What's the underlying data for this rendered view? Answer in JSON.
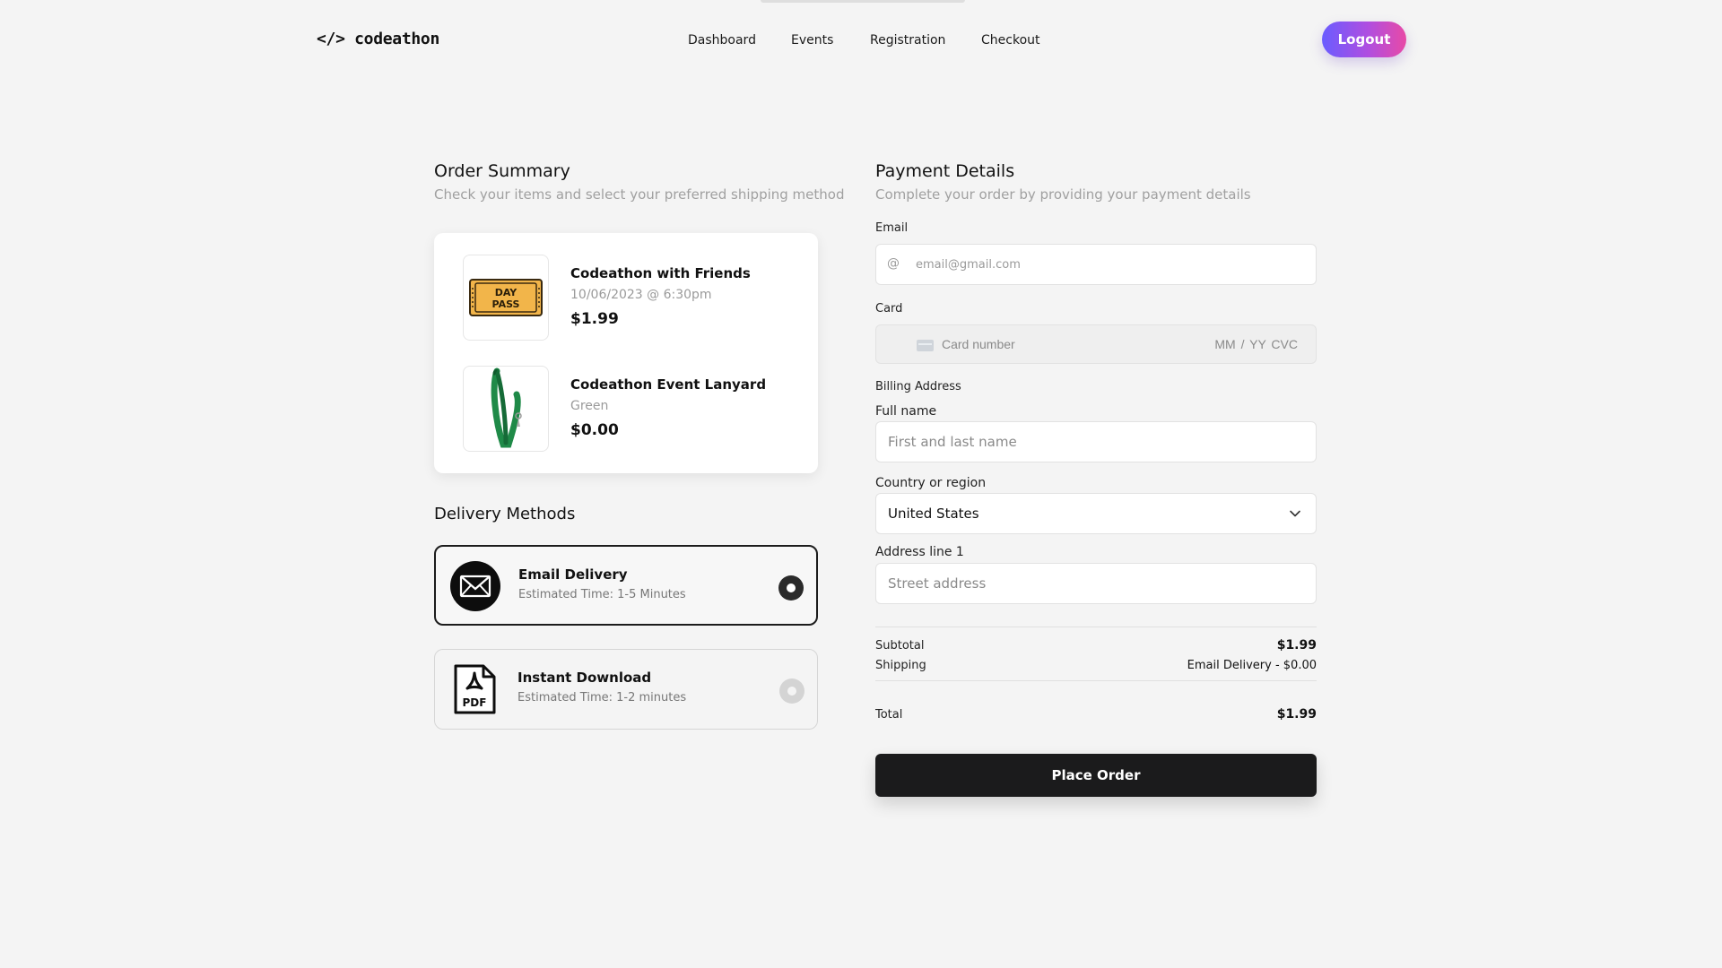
{
  "header": {
    "logo": "</> codeathon",
    "nav": [
      "Dashboard",
      "Events",
      "Registration",
      "Checkout"
    ],
    "logout_label": "Logout"
  },
  "order_summary": {
    "title": "Order Summary",
    "subtitle": "Check your items and select your preferred shipping method",
    "items": [
      {
        "name": "Codeathon with Friends",
        "meta": "10/06/2023 @ 6:30pm",
        "price": "$1.99",
        "image": "day-pass-ticket-icon",
        "image_text": "DAY PASS"
      },
      {
        "name": "Codeathon Event Lanyard",
        "meta": "Green",
        "price": "$0.00",
        "image": "green-lanyard-icon"
      }
    ]
  },
  "delivery": {
    "title": "Delivery Methods",
    "methods": [
      {
        "title": "Email Delivery",
        "subtitle": "Estimated Time: 1-5 Minutes",
        "icon": "envelope-icon",
        "selected": true
      },
      {
        "title": "Instant Download",
        "subtitle": "Estimated Time: 1-2 minutes",
        "icon": "pdf-file-icon",
        "icon_text": "PDF",
        "selected": false
      }
    ]
  },
  "payment": {
    "title": "Payment Details",
    "subtitle": "Complete your order by providing your payment details",
    "email_label": "Email",
    "email_placeholder": "email@gmail.com",
    "card_label": "Card",
    "card_placeholder": "Card number",
    "card_expiry_cvc": "MM / YY  CVC",
    "billing_label": "Billing Address",
    "fullname_label": "Full name",
    "fullname_placeholder": "First and last name",
    "country_label": "Country or region",
    "country_value": "United States",
    "address_label": "Address line 1",
    "address_placeholder": "Street address"
  },
  "summary": {
    "subtotal_label": "Subtotal",
    "subtotal_value": "$1.99",
    "shipping_label": "Shipping",
    "shipping_value": "Email Delivery - $0.00",
    "total_label": "Total",
    "total_value": "$1.99"
  },
  "place_order_label": "Place Order",
  "colors": {
    "background": "#f4f4f4",
    "logout_gradient_start": "#6a5cff",
    "logout_gradient_end": "#e84aa6",
    "primary_button": "#1b1b1c",
    "ticket": "#f2b54a",
    "lanyard": "#1f8a48"
  }
}
